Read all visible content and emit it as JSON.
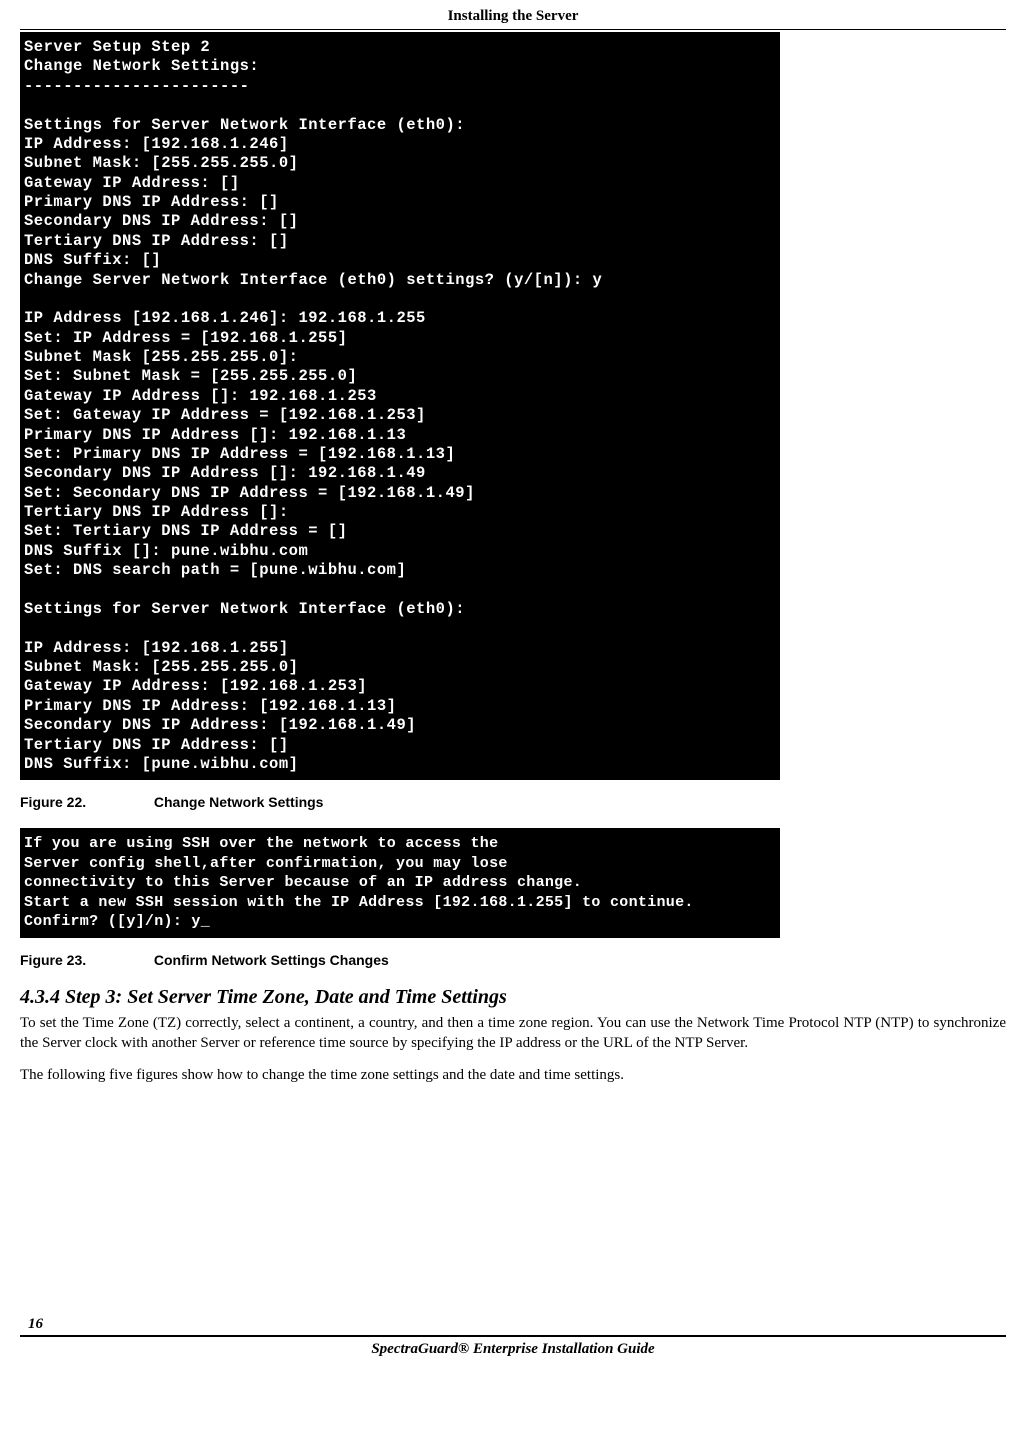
{
  "header": "Installing the Server",
  "terminal1": "Server Setup Step 2\nChange Network Settings:\n-----------------------\n\nSettings for Server Network Interface (eth0):\nIP Address: [192.168.1.246]\nSubnet Mask: [255.255.255.0]\nGateway IP Address: []\nPrimary DNS IP Address: []\nSecondary DNS IP Address: []\nTertiary DNS IP Address: []\nDNS Suffix: []\nChange Server Network Interface (eth0) settings? (y/[n]): y\n\nIP Address [192.168.1.246]: 192.168.1.255\nSet: IP Address = [192.168.1.255]\nSubnet Mask [255.255.255.0]:\nSet: Subnet Mask = [255.255.255.0]\nGateway IP Address []: 192.168.1.253\nSet: Gateway IP Address = [192.168.1.253]\nPrimary DNS IP Address []: 192.168.1.13\nSet: Primary DNS IP Address = [192.168.1.13]\nSecondary DNS IP Address []: 192.168.1.49\nSet: Secondary DNS IP Address = [192.168.1.49]\nTertiary DNS IP Address []:\nSet: Tertiary DNS IP Address = []\nDNS Suffix []: pune.wibhu.com\nSet: DNS search path = [pune.wibhu.com]\n\nSettings for Server Network Interface (eth0):\n\nIP Address: [192.168.1.255]\nSubnet Mask: [255.255.255.0]\nGateway IP Address: [192.168.1.253]\nPrimary DNS IP Address: [192.168.1.13]\nSecondary DNS IP Address: [192.168.1.49]\nTertiary DNS IP Address: []\nDNS Suffix: [pune.wibhu.com]\n",
  "figure22": {
    "num": "Figure  22.",
    "title": "Change Network Settings"
  },
  "terminal2": "If you are using SSH over the network to access the\nServer config shell,after confirmation, you may lose\nconnectivity to this Server because of an IP address change.\nStart a new SSH session with the IP Address [192.168.1.255] to continue.\nConfirm? ([y]/n): y_",
  "figure23": {
    "num": "Figure  23.",
    "title": "Confirm Network Settings Changes"
  },
  "section": {
    "heading": "4.3.4    Step 3: Set Server Time Zone, Date and Time Settings",
    "para1": "To set the Time Zone (TZ) correctly, select a continent, a country, and then a time zone region. You can use the Network Time Protocol NTP (NTP) to synchronize the Server clock with another Server or reference time source by specifying the IP address or the URL of the NTP Server.",
    "para2": "The following five figures show how to change the time zone settings and the date and time settings."
  },
  "footer": {
    "page": "16",
    "title": "SpectraGuard® Enterprise Installation Guide"
  }
}
